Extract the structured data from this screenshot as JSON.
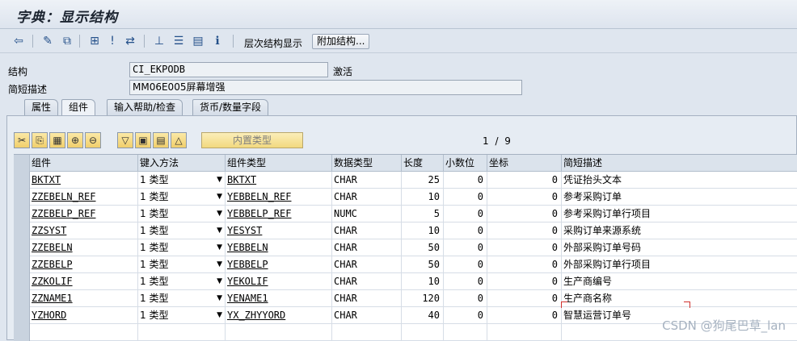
{
  "title": "字典：显示结构",
  "toolbar": {
    "icons": [
      "back-icon",
      "edit-icon",
      "other-object-icon",
      "where-used-icon",
      "activate-icon",
      "navigate-icon",
      "hierarchy-icon",
      "layout-icon",
      "list-icon",
      "info-icon"
    ],
    "hierarchy_label": "层次结构显示",
    "append_button": "附加结构..."
  },
  "form": {
    "structure_label": "结构",
    "structure_value": "CI_EKPODB",
    "status": "激活",
    "desc_label": "简短描述",
    "desc_value": "MM06E005屏幕增强"
  },
  "tabs": [
    "属性",
    "组件",
    "输入帮助/检查",
    "货币/数量字段"
  ],
  "active_tab": "组件",
  "grid_toolbar": {
    "builtin_type_button": "内置类型",
    "pager": "1 / 9"
  },
  "grid": {
    "columns": [
      "组件",
      "键入方法",
      "组件类型",
      "数据类型",
      "长度",
      "小数位",
      "坐标",
      "简短描述"
    ],
    "rows": [
      {
        "component": "BKTXT",
        "method": "1 类型",
        "type": "BKTXT",
        "dtype": "CHAR",
        "length": "25",
        "decimals": "0",
        "coord": "0",
        "desc": "凭证抬头文本"
      },
      {
        "component": "ZZEBELN_REF",
        "method": "1 类型",
        "type": "YEBBELN_REF",
        "dtype": "CHAR",
        "length": "10",
        "decimals": "0",
        "coord": "0",
        "desc": "参考采购订单"
      },
      {
        "component": "ZZEBELP_REF",
        "method": "1 类型",
        "type": "YEBBELP_REF",
        "dtype": "NUMC",
        "length": "5",
        "decimals": "0",
        "coord": "0",
        "desc": "参考采购订单行项目"
      },
      {
        "component": "ZZSYST",
        "method": "1 类型",
        "type": "YESYST",
        "dtype": "CHAR",
        "length": "10",
        "decimals": "0",
        "coord": "0",
        "desc": "采购订单来源系统"
      },
      {
        "component": "ZZEBELN",
        "method": "1 类型",
        "type": "YEBBELN",
        "dtype": "CHAR",
        "length": "50",
        "decimals": "0",
        "coord": "0",
        "desc": "外部采购订单号码"
      },
      {
        "component": "ZZEBELP",
        "method": "1 类型",
        "type": "YEBBELP",
        "dtype": "CHAR",
        "length": "50",
        "decimals": "0",
        "coord": "0",
        "desc": "外部采购订单行项目"
      },
      {
        "component": "ZZKOLIF",
        "method": "1 类型",
        "type": "YEKOLIF",
        "dtype": "CHAR",
        "length": "10",
        "decimals": "0",
        "coord": "0",
        "desc": "生产商编号"
      },
      {
        "component": "ZZNAME1",
        "method": "1 类型",
        "type": "YENAME1",
        "dtype": "CHAR",
        "length": "120",
        "decimals": "0",
        "coord": "0",
        "desc": "生产商名称"
      },
      {
        "component": "YZHORD",
        "method": "1 类型",
        "type": "YX_ZHYYORD",
        "dtype": "CHAR",
        "length": "40",
        "decimals": "0",
        "coord": "0",
        "desc": "智慧运营订单号"
      }
    ]
  },
  "watermark": "CSDN @狗尾巴草_lan"
}
